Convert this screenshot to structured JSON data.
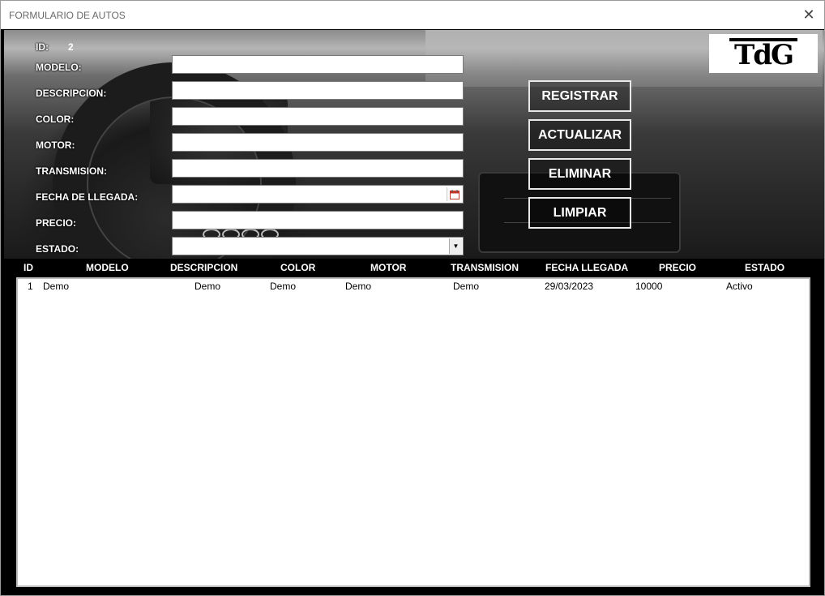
{
  "window": {
    "title": "FORMULARIO DE AUTOS",
    "close_glyph": "✕"
  },
  "logo": {
    "text": "TdG"
  },
  "form": {
    "id_label": "ID:",
    "id_value": "2",
    "labels": {
      "modelo": "MODELO:",
      "descripcion": "DESCRIPCION:",
      "color": "COLOR:",
      "motor": "MOTOR:",
      "transmision": "TRANSMISION:",
      "fecha": "FECHA DE LLEGADA:",
      "precio": "PRECIO:",
      "estado": "ESTADO:"
    },
    "values": {
      "modelo": "",
      "descripcion": "",
      "color": "",
      "motor": "",
      "transmision": "",
      "fecha": "",
      "precio": "",
      "estado": ""
    }
  },
  "buttons": {
    "registrar": "REGISTRAR",
    "actualizar": "ACTUALIZAR",
    "eliminar": "ELIMINAR",
    "limpiar": "LIMPIAR"
  },
  "table": {
    "headers": [
      "ID",
      "MODELO",
      "DESCRIPCION",
      "COLOR",
      "MOTOR",
      "TRANSMISION",
      "FECHA LLEGADA",
      "PRECIO",
      "ESTADO"
    ],
    "rows": [
      [
        "1",
        "Demo",
        "Demo",
        "Demo",
        "Demo",
        "Demo",
        "29/03/2023",
        "10000",
        "Activo"
      ]
    ]
  },
  "icons": {
    "calendar": "calendar-icon",
    "dropdown": "chevron-down-icon",
    "close": "close-icon"
  }
}
